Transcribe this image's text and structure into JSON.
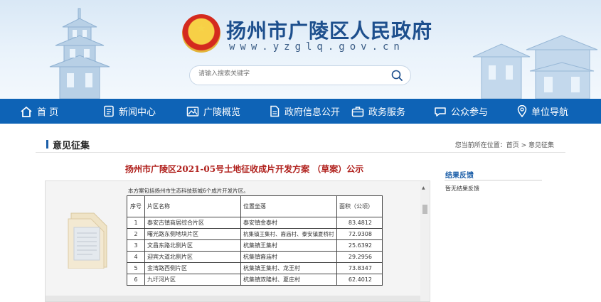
{
  "header": {
    "site_title": "扬州市广陵区人民政府",
    "site_url": "www.yzglq.gov.cn",
    "search_placeholder": "请输入搜索关键字"
  },
  "nav": {
    "items": [
      {
        "label": "首 页",
        "icon": "home-icon"
      },
      {
        "label": "新闻中心",
        "icon": "news-icon"
      },
      {
        "label": "广陵概览",
        "icon": "picture-icon"
      },
      {
        "label": "政府信息公开",
        "icon": "document-icon"
      },
      {
        "label": "政务服务",
        "icon": "briefcase-icon"
      },
      {
        "label": "公众参与",
        "icon": "chat-icon"
      },
      {
        "label": "单位导航",
        "icon": "location-icon"
      }
    ]
  },
  "section": {
    "title": "意见征集",
    "breadcrumb": "您当前所在位置：首页 > 意见征集"
  },
  "document": {
    "title": "扬州市广陵区2021-05号土地征收成片开发方案 （草案）公示",
    "note": "本方案包括扬州市生态科技新城6个成片开发片区。",
    "table": {
      "headers": [
        "序号",
        "片区名称",
        "位置坐落",
        "面积（公顷）"
      ],
      "rows": [
        [
          "1",
          "泰安古镇商居综合片区",
          "泰安镇金泰村",
          "83.4812"
        ],
        [
          "2",
          "曙光路东侧地块片区",
          "杭集镇王集村、裔庙村、泰安镇夏桥村",
          "72.9308"
        ],
        [
          "3",
          "文昌东路北侧片区",
          "杭集镇王集村",
          "25.6392"
        ],
        [
          "4",
          "迎宾大道北侧片区",
          "杭集镇裔庙村",
          "29.2956"
        ],
        [
          "5",
          "金湾路西侧片区",
          "杭集镇王集村、龙王村",
          "73.8347"
        ],
        [
          "6",
          "九圩河片区",
          "杭集镇双隆村、夏庄村",
          "62.4012"
        ]
      ]
    }
  },
  "sidebar": {
    "title": "结果反馈",
    "text": "暂无结果反馈"
  },
  "colors": {
    "nav_bg": "#0e63b6",
    "title_red": "#b0201c",
    "brand_blue": "#1d4f8d"
  }
}
